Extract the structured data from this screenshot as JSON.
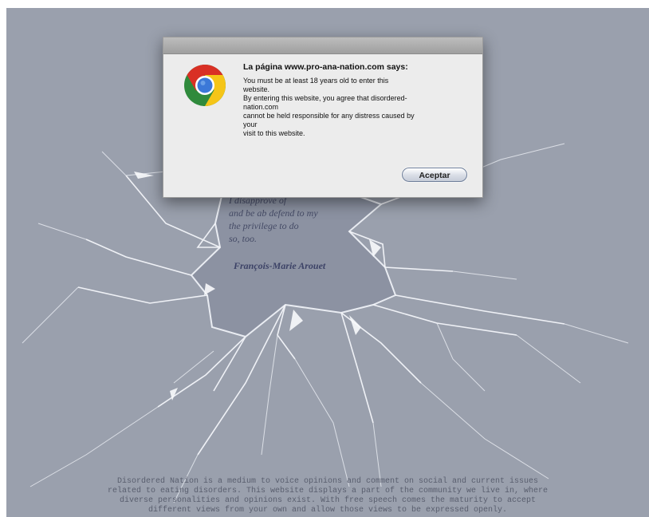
{
  "background": {
    "color": "#9aa0ad"
  },
  "quote": {
    "lines": [
      "I disapprove of",
      "and be ab defend to my",
      "the privilege to do",
      "so, too."
    ],
    "author": "François-Marie Arouet"
  },
  "footer": {
    "lines": [
      "Disordered Nation is a medium to voice opinions and comment on social and current issues",
      "related to eating disorders. This website displays a part of the community we live in, where",
      "diverse personalities and opinions exist. With free speech comes the maturity to accept",
      "different views from your own and allow those views to be expressed openly."
    ]
  },
  "dialog": {
    "icon": "chrome-icon",
    "heading": "La página www.pro-ana-nation.com says:",
    "message_lines": [
      "You must be at least 18 years old to enter this",
      "website.",
      "By entering this website, you agree that disordered-",
      "nation.com",
      "cannot be held responsible for any distress caused by",
      "your",
      "visit to this website."
    ],
    "accept_label": "Aceptar"
  }
}
